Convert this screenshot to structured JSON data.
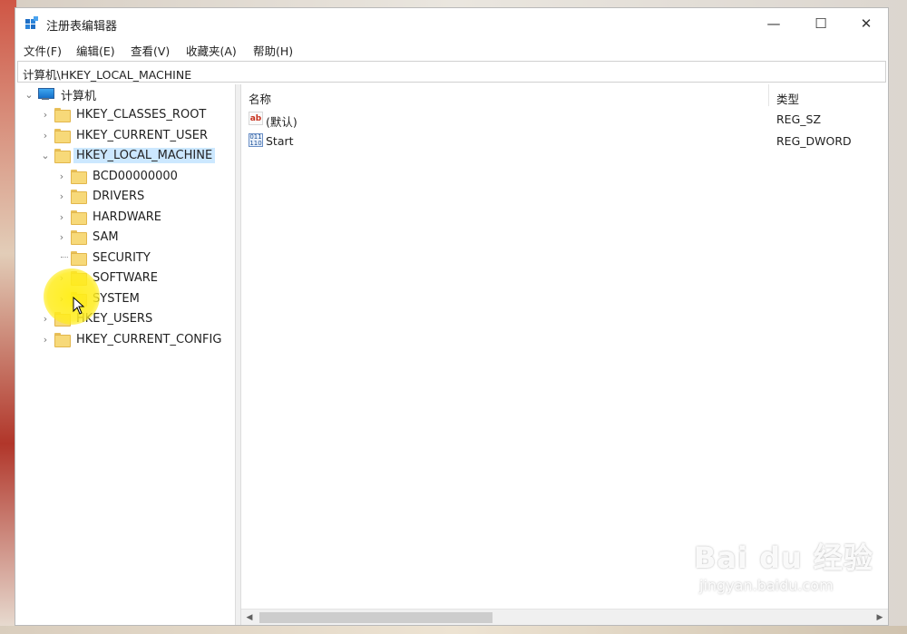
{
  "window": {
    "title": "注册表编辑器",
    "minimize_glyph": "—",
    "maximize_glyph": "☐",
    "close_glyph": "✕"
  },
  "menu": [
    "文件(F)",
    "编辑(E)",
    "查看(V)",
    "收藏夹(A)",
    "帮助(H)"
  ],
  "address": "计算机\\HKEY_LOCAL_MACHINE",
  "tree": {
    "root": "计算机",
    "hives": {
      "classes_root": "HKEY_CLASSES_ROOT",
      "current_user": "HKEY_CURRENT_USER",
      "local_machine": "HKEY_LOCAL_MACHINE",
      "users": "HKEY_USERS",
      "current_config": "HKEY_CURRENT_CONFIG"
    },
    "local_machine_children": [
      "BCD00000000",
      "DRIVERS",
      "HARDWARE",
      "SAM",
      "SECURITY",
      "SOFTWARE",
      "SYSTEM"
    ],
    "selected": "HKEY_LOCAL_MACHINE"
  },
  "list": {
    "columns": {
      "name": "名称",
      "type": "类型"
    },
    "rows": [
      {
        "name": "(默认)",
        "type": "REG_SZ",
        "icon": "string-value-icon"
      },
      {
        "name": "Start",
        "type": "REG_DWORD",
        "icon": "binary-value-icon"
      }
    ]
  },
  "watermark": {
    "brand": "Bai du 经验",
    "url": "jingyan.baidu.com"
  },
  "colors": {
    "selection": "#cce8ff",
    "folder": "#f7d979",
    "highlight": "#ffee14"
  }
}
